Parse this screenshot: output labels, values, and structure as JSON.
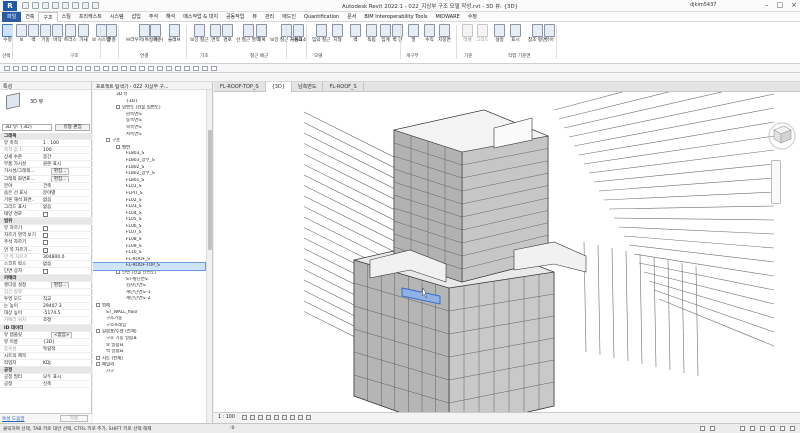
{
  "window": {
    "title": "Autodesk Revit 2022.1 - 022_지상부 구조 모델 작성.rvt - 3D 뷰: {3D}",
    "user": "djkim5437"
  },
  "tabs": [
    "파일",
    "건축",
    "구조",
    "스틸",
    "프리캐스트",
    "시스템",
    "삽입",
    "주석",
    "해석",
    "매스작업 & 대지",
    "공동작업",
    "뷰",
    "관리",
    "애드인",
    "Quantification",
    "문서",
    "BIM Interoperability Tools",
    "MIDWARE",
    "수정"
  ],
  "ribbon": {
    "buttons": [
      "수정",
      "보",
      "벽",
      "기둥",
      "바닥",
      "트러스",
      "가새",
      "보 시스템",
      "연결",
      "브라우저(특정기준)",
      "배",
      "슬래브",
      "보강 철근",
      "면적",
      "경로",
      "선 철근 영역",
      "피복",
      "보강 철근 커플러",
      "구성요소",
      "임의 철근",
      "지형",
      "벽",
      "독립",
      "임계",
      "벽 면",
      "열",
      "수직",
      "지붕면",
      "레벨",
      "그리드",
      "설정",
      "표시",
      "참조 평면",
      "뷰어"
    ],
    "groups": [
      "선택",
      "구조",
      "연결",
      "기초",
      "철근 배근",
      "모델",
      "개구부",
      "기준",
      "작업 기준면"
    ]
  },
  "properties": {
    "header": "특성",
    "type": "3D 뷰",
    "combo": "3D 뷰: {3D}",
    "edit_type": "유형 편집",
    "rows": [
      {
        "k": "그래픽",
        "v": "",
        "grp": true
      },
      {
        "k": "뷰 축척",
        "v": "1 : 100"
      },
      {
        "k": "축척 값 1:",
        "v": "100",
        "dim": true
      },
      {
        "k": "상세 수준",
        "v": "중간"
      },
      {
        "k": "부품 가시성",
        "v": "원본 표시"
      },
      {
        "k": "가시성/그래픽...",
        "v": "편집...",
        "btn": true
      },
      {
        "k": "그래픽 화면표...",
        "v": "편집...",
        "btn": true
      },
      {
        "k": "분야",
        "v": "건축"
      },
      {
        "k": "숨은 선 표시",
        "v": "분야별"
      },
      {
        "k": "기본 해석 화면..",
        "v": "없음"
      },
      {
        "k": "그리드 표시",
        "v": "없음"
      },
      {
        "k": "태양 경로",
        "v": "",
        "cb": true
      },
      {
        "k": "범위",
        "v": "",
        "grp": true
      },
      {
        "k": "뷰 자르기",
        "v": "",
        "cb": true
      },
      {
        "k": "자르기 영역 보기",
        "v": "",
        "cb": true
      },
      {
        "k": "주석 자르기",
        "v": "",
        "cb": true
      },
      {
        "k": "먼 쪽 자르기...",
        "v": "",
        "cb": true
      },
      {
        "k": "먼 쪽 자르기",
        "v": "304800.0",
        "dim": true
      },
      {
        "k": "스코프 박스",
        "v": "없음"
      },
      {
        "k": "단면 상자",
        "v": "",
        "cb": true
      },
      {
        "k": "카메라",
        "v": "",
        "grp": true
      },
      {
        "k": "렌더링 설정",
        "v": "편집...",
        "btn": true
      },
      {
        "k": "잠긴 방향",
        "v": "",
        "dim": true
      },
      {
        "k": "투영 모드",
        "v": "직교"
      },
      {
        "k": "눈 높이",
        "v": "29407.3"
      },
      {
        "k": "대상 높이",
        "v": "-5174.5"
      },
      {
        "k": "카메라 위치",
        "v": "조정",
        "dim": true
      },
      {
        "k": "ID 데이터",
        "v": "",
        "grp": true
      },
      {
        "k": "뷰 템플릿",
        "v": "<없음>",
        "btn": true
      },
      {
        "k": "뷰 이름",
        "v": "{3D}"
      },
      {
        "k": "종속성",
        "v": "독립적",
        "dim": true
      },
      {
        "k": "시트의 제목",
        "v": ""
      },
      {
        "k": "작업자",
        "v": "KDJ"
      },
      {
        "k": "공정",
        "v": "",
        "grp": true
      },
      {
        "k": "공정 필터",
        "v": "모두 표시"
      },
      {
        "k": "공정",
        "v": "신축"
      }
    ],
    "help_link": "특성 도움말",
    "apply": "적용"
  },
  "browser": {
    "header": "프로젝트 탐색기 - 022_지상부 구...",
    "items": [
      {
        "t": "3D 뷰",
        "l": 2
      },
      {
        "t": "{3D}",
        "l": 3
      },
      {
        "t": "입면도 (건물 입면도)",
        "l": 2,
        "tg": true
      },
      {
        "t": "남측면도",
        "l": 3
      },
      {
        "t": "동측면도",
        "l": 3
      },
      {
        "t": "북측면도",
        "l": 3
      },
      {
        "t": "서측면도",
        "l": 3
      },
      {
        "t": "구조",
        "l": 1,
        "tg": true
      },
      {
        "t": "평면",
        "l": 2,
        "tg": true
      },
      {
        "t": "FL803_S",
        "l": 3
      },
      {
        "t": "FL803_상부_S",
        "l": 3
      },
      {
        "t": "FL802_S",
        "l": 3
      },
      {
        "t": "FL802_상부_S",
        "l": 3
      },
      {
        "t": "FL801_S",
        "l": 3
      },
      {
        "t": "FL01_S",
        "l": 3
      },
      {
        "t": "FLPIT_S",
        "l": 3
      },
      {
        "t": "FL02_S",
        "l": 3
      },
      {
        "t": "FL03_S",
        "l": 3
      },
      {
        "t": "FL04_S",
        "l": 3
      },
      {
        "t": "FL05_S",
        "l": 3
      },
      {
        "t": "FL06_S",
        "l": 3
      },
      {
        "t": "FL07_S",
        "l": 3
      },
      {
        "t": "FL08_S",
        "l": 3
      },
      {
        "t": "FL09_S",
        "l": 3
      },
      {
        "t": "FL10_S",
        "l": 3
      },
      {
        "t": "FL-ROOF_S",
        "l": 3
      },
      {
        "t": "FL-ROOF-TOP_S",
        "l": 3,
        "hl": true
      },
      {
        "t": "단면 (건물 단면도)",
        "l": 2,
        "tg": true
      },
      {
        "t": "ST-횡단면도",
        "l": 3
      },
      {
        "t": "검사단면도",
        "l": 3
      },
      {
        "t": "계단단면도-1",
        "l": 3
      },
      {
        "t": "계단단면도-2",
        "l": 3
      },
      {
        "t": "범례",
        "l": 0,
        "tg": true
      },
      {
        "t": "ST_WALL_floor",
        "l": 1
      },
      {
        "t": "구조기둥",
        "l": 1
      },
      {
        "t": "구조프레임",
        "l": 1
      },
      {
        "t": "일람표/수량 (전체)",
        "l": 0,
        "tg": true
      },
      {
        "t": "구조 기둥 일람표",
        "l": 1
      },
      {
        "t": "보 일람표",
        "l": 1
      },
      {
        "t": "벽 일람표",
        "l": 1
      },
      {
        "t": "시트 (전체)",
        "l": 0,
        "tg": true
      },
      {
        "t": "패밀리",
        "l": 0,
        "tg": true
      },
      {
        "t": "가구",
        "l": 1
      }
    ]
  },
  "view_tabs": [
    "FL-ROOF-TOP_S",
    "{3D}",
    "남측면도",
    "FL-ROOF_S"
  ],
  "view_control": {
    "scale": "1 : 100"
  },
  "status": {
    "text": "클릭하여 선택, TAB 키로 대안 선택, CTRL 키로 추가, SHIFT 키로 선택 해제",
    "model": ":0"
  }
}
